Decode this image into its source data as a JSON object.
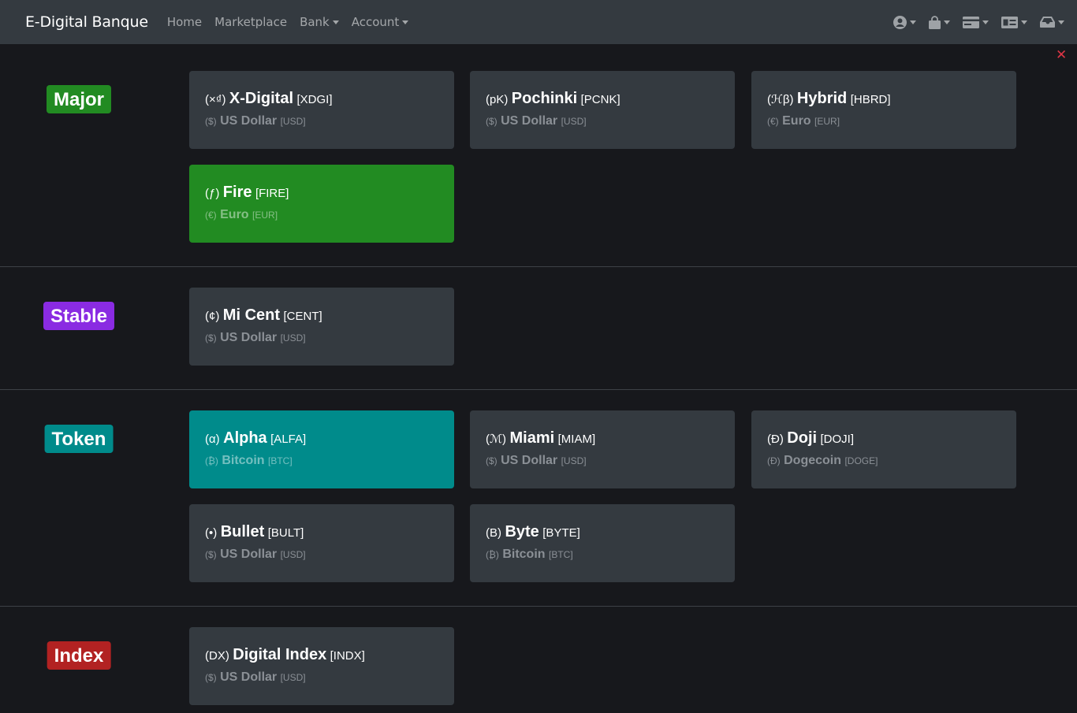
{
  "nav": {
    "brand": "E-Digital Banque",
    "links": [
      {
        "label": "Home"
      },
      {
        "label": "Marketplace"
      },
      {
        "label": "Bank"
      },
      {
        "label": "Account"
      }
    ],
    "icons": [
      "user-circle-icon",
      "shopping-bag-icon",
      "credit-card-icon",
      "money-bill-icon",
      "inbox-icon"
    ]
  },
  "close_icon": "✕",
  "colors": {
    "major": "#228b22",
    "stable": "#8a2be2",
    "token": "#008b8b",
    "index": "#b22222",
    "card": "#343a40",
    "navbar": "#343a40",
    "background": "#17181c"
  },
  "sections": [
    {
      "badge": "Major",
      "cards": [
        {
          "symbol": "(×₫)",
          "name": "X-Digital",
          "code": "[XDGI]",
          "sub_symbol": "($)",
          "sub_name": "US Dollar",
          "sub_code": "[USD]"
        },
        {
          "symbol": "(pK)",
          "name": "Pochinki",
          "code": "[PCNK]",
          "sub_symbol": "($)",
          "sub_name": "US Dollar",
          "sub_code": "[USD]"
        },
        {
          "symbol": "(ℋβ)",
          "name": "Hybrid",
          "code": "[HBRD]",
          "sub_symbol": "(€)",
          "sub_name": "Euro",
          "sub_code": "[EUR]"
        },
        {
          "symbol": "(ƒ)",
          "name": "Fire",
          "code": "[FIRE]",
          "sub_symbol": "(€)",
          "sub_name": "Euro",
          "sub_code": "[EUR]"
        }
      ]
    },
    {
      "badge": "Stable",
      "cards": [
        {
          "symbol": "(¢)",
          "name": "Mi Cent",
          "code": "[CENT]",
          "sub_symbol": "($)",
          "sub_name": "US Dollar",
          "sub_code": "[USD]"
        }
      ]
    },
    {
      "badge": "Token",
      "cards": [
        {
          "symbol": "(α)",
          "name": "Alpha",
          "code": "[ALFA]",
          "sub_symbol": "(₿)",
          "sub_name": "Bitcoin",
          "sub_code": "[BTC]"
        },
        {
          "symbol": "(ℳ)",
          "name": "Miami",
          "code": "[MIAM]",
          "sub_symbol": "($)",
          "sub_name": "US Dollar",
          "sub_code": "[USD]"
        },
        {
          "symbol": "(Đ)",
          "name": "Doji",
          "code": "[DOJI]",
          "sub_symbol": "(Đ)",
          "sub_name": "Dogecoin",
          "sub_code": "[DOGE]"
        },
        {
          "symbol": "(•)",
          "name": "Bullet",
          "code": "[BULT]",
          "sub_symbol": "($)",
          "sub_name": "US Dollar",
          "sub_code": "[USD]"
        },
        {
          "symbol": "(B)",
          "name": "Byte",
          "code": "[BYTE]",
          "sub_symbol": "(₿)",
          "sub_name": "Bitcoin",
          "sub_code": "[BTC]"
        }
      ]
    },
    {
      "badge": "Index",
      "cards": [
        {
          "symbol": "(DX)",
          "name": "Digital Index",
          "code": "[INDX]",
          "sub_symbol": "($)",
          "sub_name": "US Dollar",
          "sub_code": "[USD]"
        }
      ]
    }
  ]
}
